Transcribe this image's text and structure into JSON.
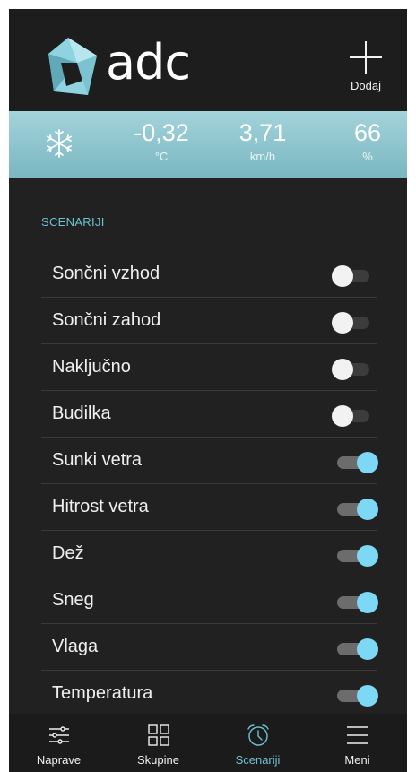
{
  "header": {
    "logo_text": "adc",
    "add_label": "Dodaj",
    "icons": {
      "logo": "adc-logo-icon",
      "add": "plus-icon"
    }
  },
  "weather": {
    "icon": "snowflake-icon",
    "temperature": {
      "value": "-0,32",
      "unit": "°C"
    },
    "wind": {
      "value": "3,71",
      "unit": "km/h"
    },
    "humidity": {
      "value": "66",
      "unit": "%"
    }
  },
  "section": {
    "title": "SCENARIJI"
  },
  "scenarios": [
    {
      "label": "Sončni vzhod",
      "enabled": false
    },
    {
      "label": "Sončni zahod",
      "enabled": false
    },
    {
      "label": "Naključno",
      "enabled": false
    },
    {
      "label": "Budilka",
      "enabled": false
    },
    {
      "label": "Sunki vetra",
      "enabled": true
    },
    {
      "label": "Hitrost vetra",
      "enabled": true
    },
    {
      "label": "Dež",
      "enabled": true
    },
    {
      "label": "Sneg",
      "enabled": true
    },
    {
      "label": "Vlaga",
      "enabled": true
    },
    {
      "label": "Temperatura",
      "enabled": true
    }
  ],
  "nav": {
    "active": "scenariji",
    "items": [
      {
        "label": "Naprave",
        "icon": "sliders-icon"
      },
      {
        "label": "Skupine",
        "icon": "grid-icon"
      },
      {
        "label": "Scenariji",
        "icon": "alarm-clock-icon"
      },
      {
        "label": "Meni",
        "icon": "menu-icon"
      }
    ]
  },
  "colors": {
    "background": "#212121",
    "accent": "#6fc0d1",
    "weather_band": "#8fc7d0",
    "toggle_on": "#7dd8f6"
  }
}
